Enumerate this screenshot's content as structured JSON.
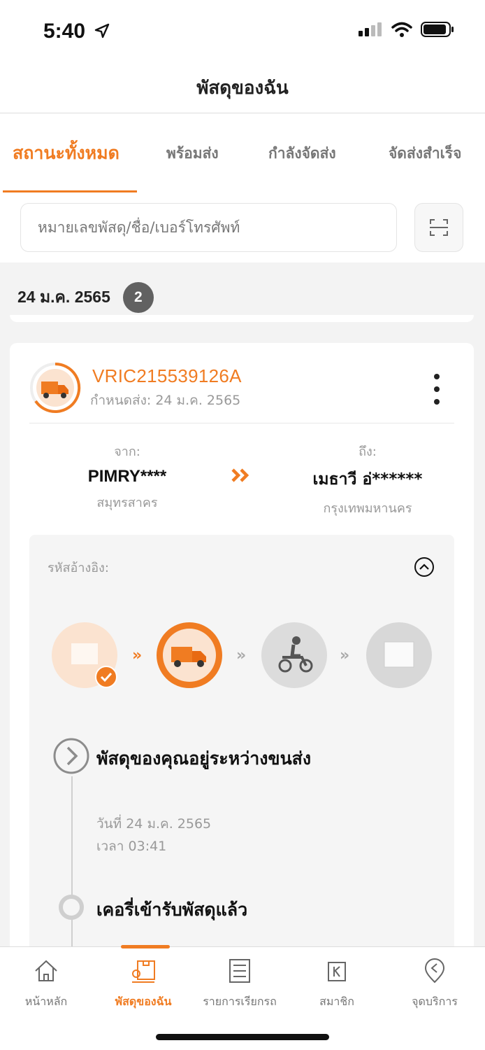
{
  "status_bar": {
    "time": "5:40"
  },
  "header": {
    "title": "พัสดุของฉัน"
  },
  "tabs": [
    {
      "label": "สถานะทั้งหมด",
      "active": true
    },
    {
      "label": "พร้อมส่ง"
    },
    {
      "label": "กำลังจัดส่ง"
    },
    {
      "label": "จัดส่งสำเร็จ"
    }
  ],
  "search": {
    "placeholder": "หมายเลขพัสดุ/ชื่อ/เบอร์โทรศัพท์"
  },
  "group": {
    "date": "24 ม.ค. 2565",
    "count": "2"
  },
  "parcel": {
    "tracking_no": "VRIC215539126A",
    "due_date": "กำหนดส่ง: 24 ม.ค. 2565",
    "from_caption": "จาก:",
    "from_name": "PIMRY****",
    "from_city": "สมุทรสาคร",
    "to_caption": "ถึง:",
    "to_name": "เมธาวี อ่******",
    "to_city": "กรุงเทพมหานคร",
    "ref_label": "รหัสอ้างอิง:",
    "timeline": [
      {
        "title": "พัสดุของคุณอยู่ระหว่างขนส่ง",
        "date": "วันที่ 24 ม.ค. 2565",
        "time": "เวลา 03:41"
      },
      {
        "title": "เคอรี่เข้ารับพัสดุแล้ว"
      }
    ]
  },
  "bottom_nav": [
    {
      "label": "หน้าหลัก",
      "icon": "home-icon"
    },
    {
      "label": "พัสดุของฉัน",
      "icon": "parcel-icon",
      "active": true
    },
    {
      "label": "รายการเรียกรถ",
      "icon": "list-icon"
    },
    {
      "label": "สมาชิก",
      "icon": "member-icon"
    },
    {
      "label": "จุดบริการ",
      "icon": "location-icon"
    }
  ],
  "colors": {
    "accent": "#f07c22",
    "muted": "#999999"
  }
}
